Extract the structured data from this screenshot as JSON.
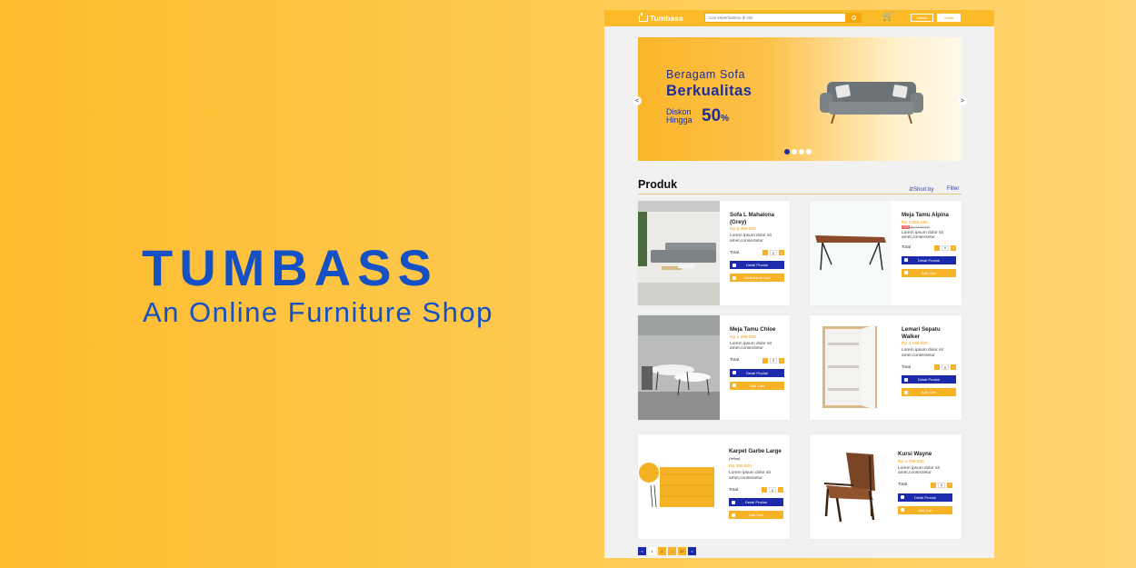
{
  "hero": {
    "title": "TUMBASS",
    "subtitle": "An Online Furniture Shop"
  },
  "navbar": {
    "logo": "Tumbass",
    "search_placeholder": "Cari keperluanmu di sini",
    "login_label": "Masuk",
    "register_label": "Daftar"
  },
  "banner": {
    "line1": "Beragam Sofa",
    "line2": "Berkualitas",
    "discount_line1": "Diskon",
    "discount_line2": "Hingga",
    "discount_value": "50",
    "discount_unit": "%",
    "prev": "<",
    "next": ">",
    "slides": 4,
    "active_slide": 1
  },
  "products_section": {
    "title": "Produk",
    "sort_label": "Short by",
    "filter_label": "Filter"
  },
  "products": [
    {
      "name": "Sofa L Mahalona (Grey)",
      "price": "Rp 5.359.000",
      "desc": "Lorem ipsum dolor sit amet,consectetur",
      "total_label": "Total",
      "qty": "2",
      "detail_label": "Detail Produk",
      "cart_label": "Tambahkan Cart"
    },
    {
      "name": "Meja Tamu Alpina",
      "price": "Rp 3.059.150",
      "old_price": "Rp 3.599.000",
      "discount": "15%",
      "desc": "Lorem ipsum dolor sit amet,consectetur",
      "total_label": "Total",
      "qty": "0",
      "detail_label": "Detail Produk",
      "cart_label": "Add Cart"
    },
    {
      "name": "Meja Tamu Chloe",
      "price": "Rp 1.899.000",
      "desc": "Lorem ipsum dolor sit amet,consectetur",
      "total_label": "Total",
      "qty": "0",
      "detail_label": "Detail Produk",
      "cart_label": "Add Cart"
    },
    {
      "name": "Lemari Sepatu Walker",
      "price": "Rp 4.199.000",
      "desc": "Lorem ipsum dolor sit amet,consectetur",
      "total_label": "Total",
      "qty": "0",
      "detail_label": "Detail Produk",
      "cart_label": "Add Cart"
    },
    {
      "name": "Karpet Garbe Large",
      "name_note": "(Yellow)",
      "price": "Rp 399.000",
      "desc": "Lorem ipsum dolor sit amet,consectetur",
      "total_label": "Total",
      "qty": "0",
      "detail_label": "Detail Produk",
      "cart_label": "Add Cart"
    },
    {
      "name": "Kursi Wayne",
      "price": "Rp 2.799.000",
      "desc": "Lorem ipsum dolor sit amet,consectetur",
      "total_label": "Total",
      "qty": "0",
      "detail_label": "Detail Produk",
      "cart_label": "Add Cart"
    }
  ],
  "pagination": {
    "prev": "«",
    "pages": [
      "1",
      "2",
      "...",
      "37"
    ],
    "next": "»"
  },
  "colors": {
    "brand_yellow": "#fbba27",
    "brand_blue": "#1c2bab",
    "hero_blue": "#1551c4",
    "price_orange": "#f49b0c"
  }
}
